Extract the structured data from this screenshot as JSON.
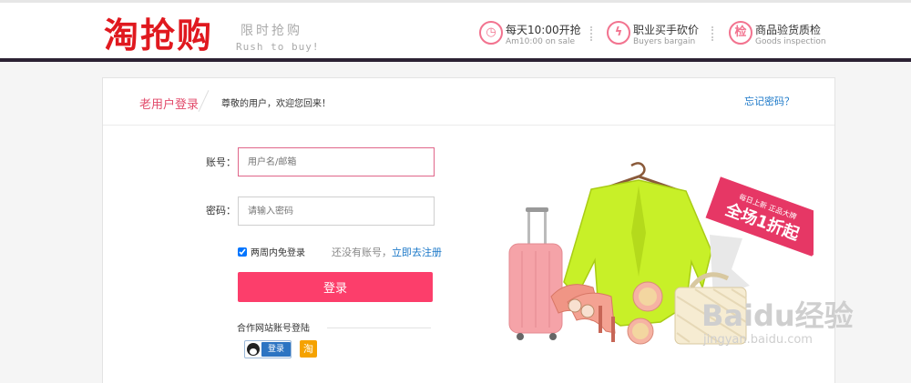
{
  "header": {
    "logo": "淘抢购",
    "slogan_cn": "限时抢购",
    "slogan_en": "Rush to buy!",
    "features": [
      {
        "icon": "clock-icon",
        "glyph": "◷",
        "title": "每天10:00开抢",
        "subtitle": "Am10:00 on sale"
      },
      {
        "icon": "lightning-icon",
        "glyph": "ϟ",
        "title": "职业买手砍价",
        "subtitle": "Buyers bargain"
      },
      {
        "icon": "inspect-icon",
        "glyph": "检",
        "title": "商品验货质检",
        "subtitle": "Goods inspection"
      }
    ]
  },
  "login": {
    "tab_title": "老用户登录",
    "welcome": "尊敬的用户，欢迎您回来！",
    "forgot_password": "忘记密码？",
    "account_label": "账号：",
    "account_placeholder": "用户名/邮箱",
    "password_label": "密码：",
    "password_placeholder": "请输入密码",
    "remember_label": "两周内免登录",
    "no_account_text": "还没有账号，",
    "register_link": "立即去注册",
    "login_button": "登录",
    "partner_title": "合作网站账号登陆",
    "qq_login": "登录",
    "taobao_label": "淘"
  },
  "promo": {
    "badge_top": "每日上新 正品大牌",
    "badge_main": "全场1折起"
  },
  "watermark": {
    "brand": "Baidu经验",
    "url": "jingyan.baidu.com"
  },
  "colors": {
    "brand_red": "#e0191f",
    "accent_pink": "#fc3e6b",
    "link_blue": "#1b78c8",
    "header_bar": "#2c2233"
  }
}
